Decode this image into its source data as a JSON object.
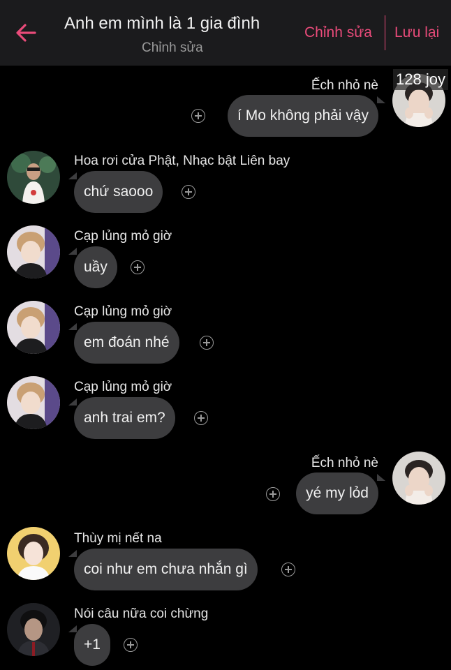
{
  "header": {
    "title": "Anh em mình là 1 gia đình",
    "subtitle": "Chỉnh sửa",
    "edit_label": "Chỉnh sửa",
    "save_label": "Lưu lại"
  },
  "overlay_text": "128 joy",
  "messages": [
    {
      "sender": "Ếch nhỏ nè",
      "text": "í Mo không phải vậy",
      "side": "right"
    },
    {
      "sender": "Hoa rơi cửa Phật, Nhạc bật Liên bay",
      "text": "chứ saooo",
      "side": "left"
    },
    {
      "sender": "Cạp lủng mỏ giờ",
      "text": "uầy",
      "side": "left"
    },
    {
      "sender": "Cạp lủng mỏ giờ",
      "text": "em đoán nhé",
      "side": "left"
    },
    {
      "sender": "Cạp lủng mỏ giờ",
      "text": "anh trai em?",
      "side": "left"
    },
    {
      "sender": "Ếch nhỏ nè",
      "text": "yé my lỏd",
      "side": "right"
    },
    {
      "sender": "Thùy mị nết na",
      "text": "coi như em chưa nhắn gì",
      "side": "left"
    },
    {
      "sender": "Nói câu nữa coi chừng",
      "text": "+1",
      "side": "left"
    }
  ],
  "colors": {
    "accent": "#e94b7a",
    "background": "#000000",
    "header": "#1b1b1d",
    "bubble": "#3d3d3f"
  }
}
